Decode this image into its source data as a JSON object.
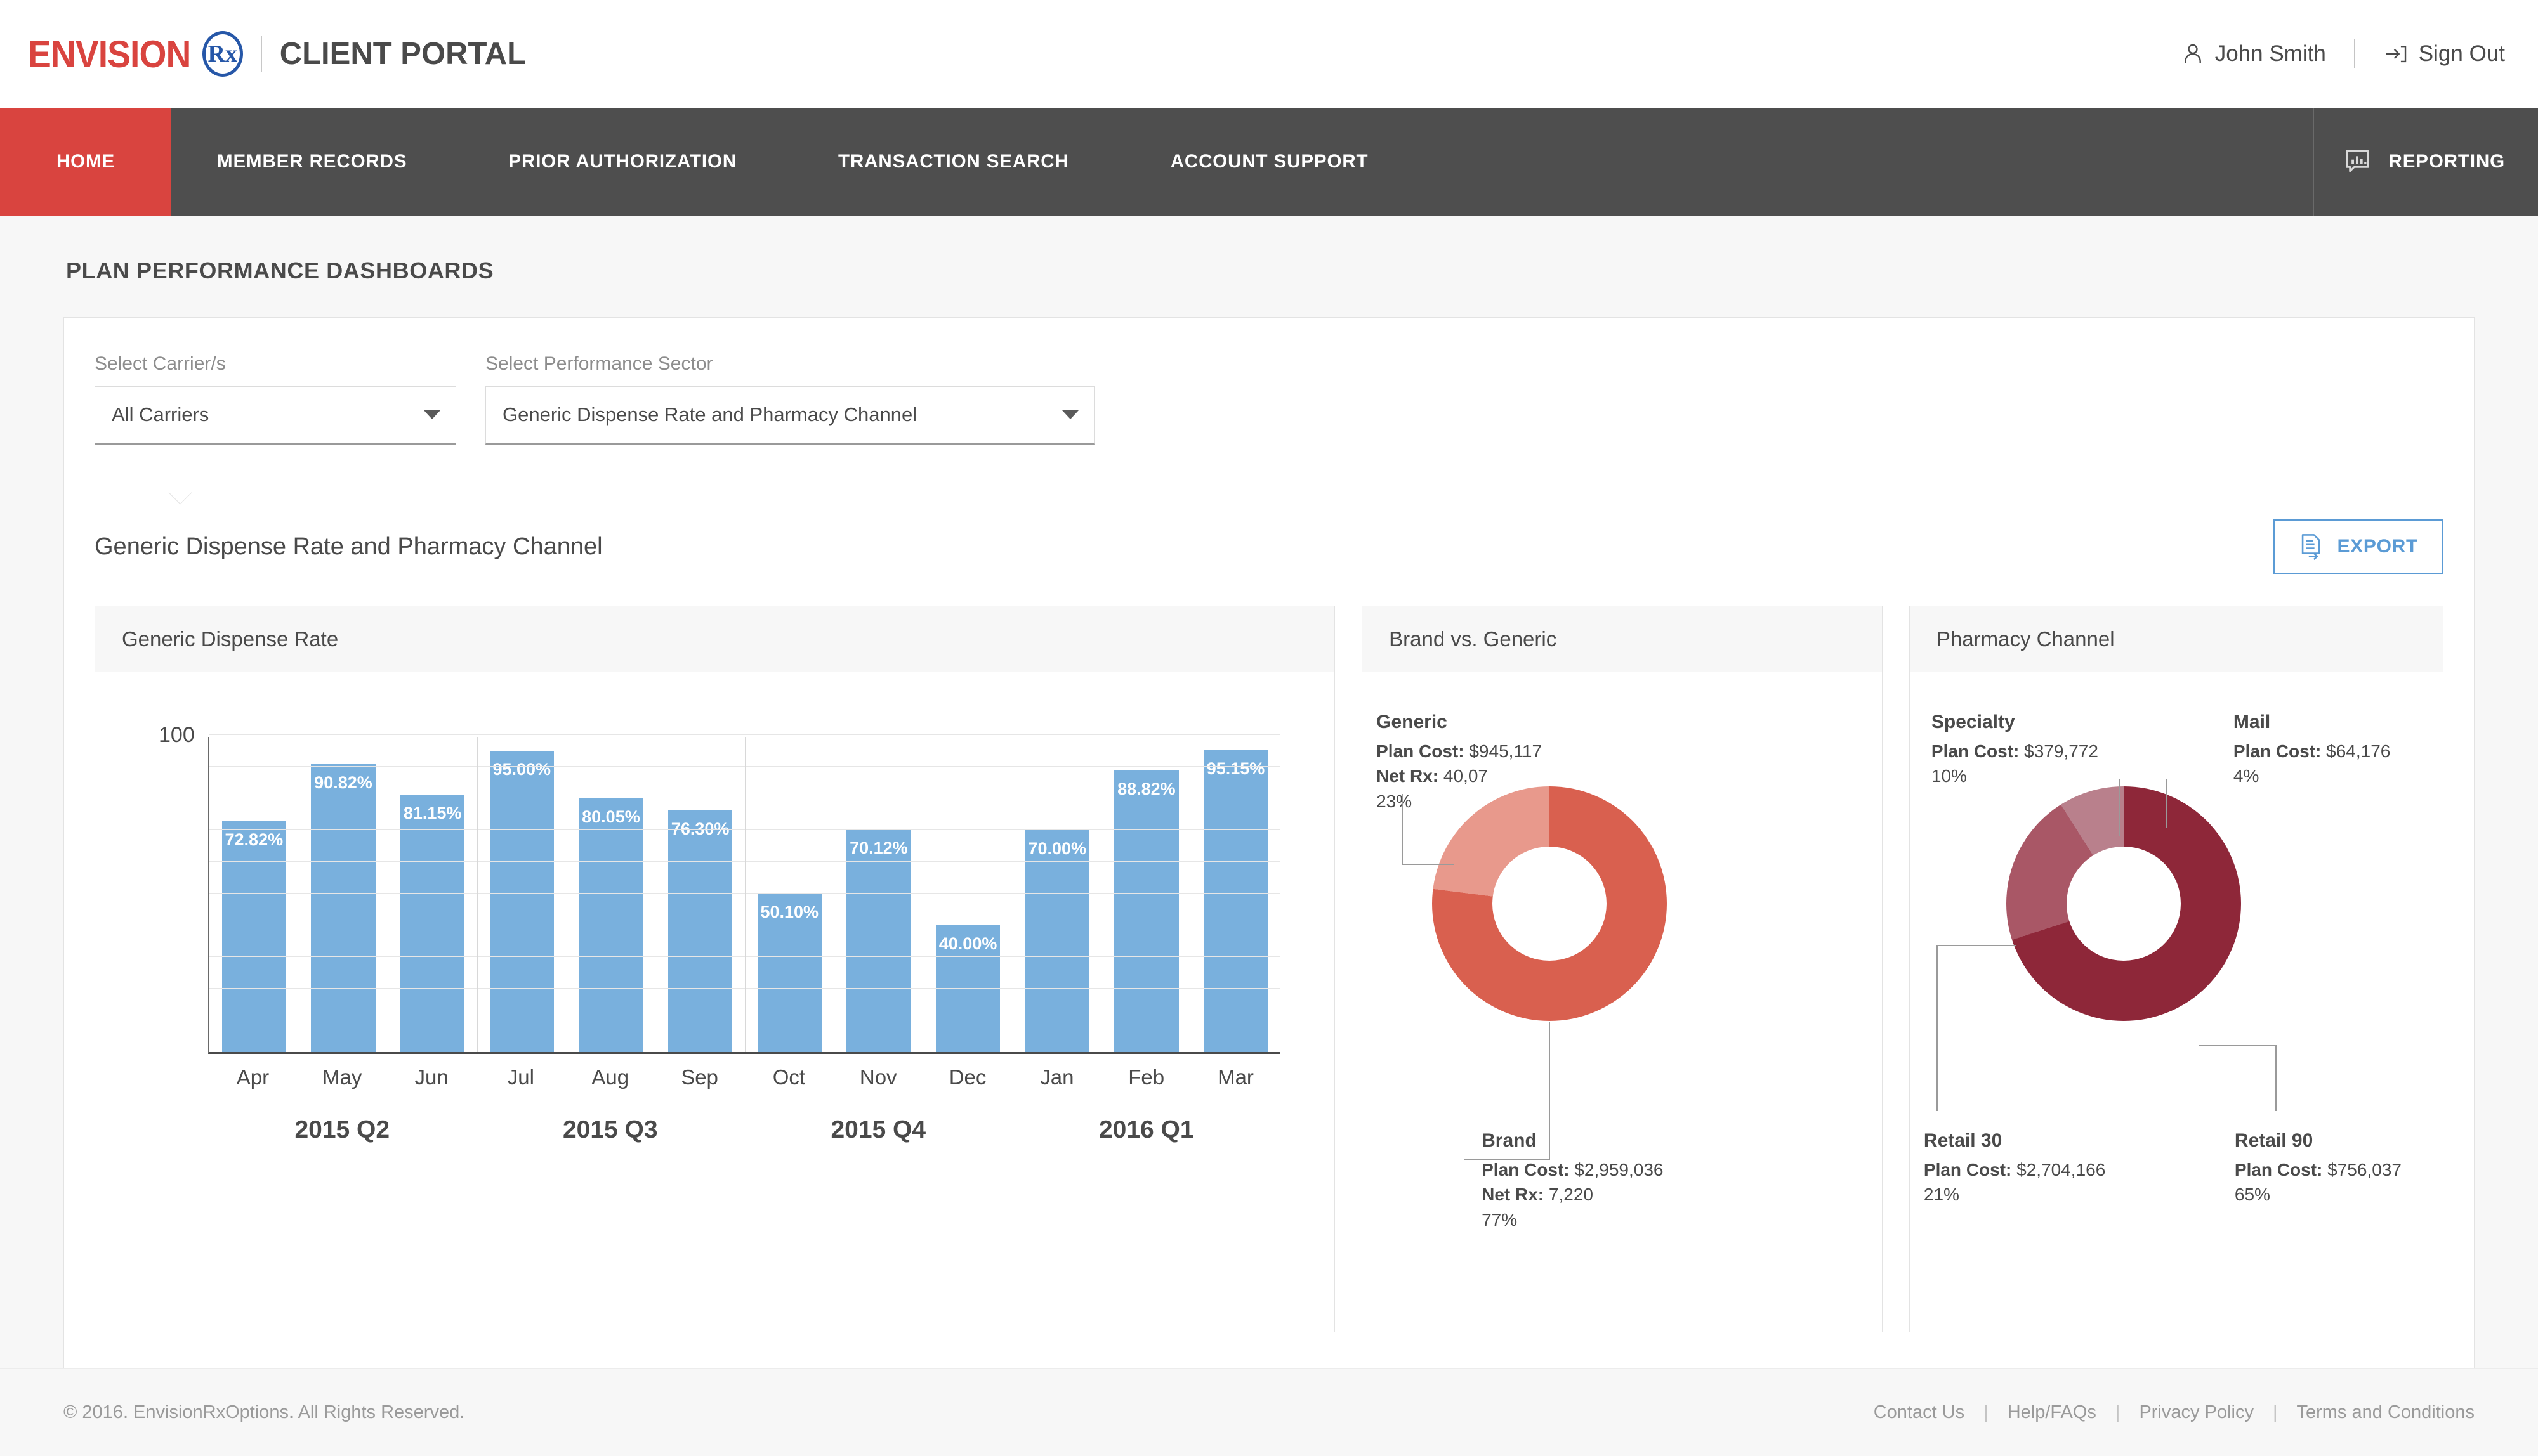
{
  "header": {
    "brand_name": "ENVISION",
    "brand_rx": "Rx",
    "portal_title": "CLIENT PORTAL",
    "user_name": "John Smith",
    "sign_out": "Sign Out"
  },
  "nav": {
    "items": [
      {
        "label": "HOME",
        "active": true
      },
      {
        "label": "MEMBER RECORDS",
        "active": false
      },
      {
        "label": "PRIOR AUTHORIZATION",
        "active": false
      },
      {
        "label": "TRANSACTION SEARCH",
        "active": false
      },
      {
        "label": "ACCOUNT SUPPORT",
        "active": false
      }
    ],
    "reporting": "REPORTING"
  },
  "page": {
    "title": "PLAN PERFORMANCE DASHBOARDS",
    "section_title": "Generic Dispense Rate and Pharmacy Channel",
    "export_label": "EXPORT"
  },
  "filters": {
    "carrier_label": "Select Carrier/s",
    "carrier_value": "All Carriers",
    "sector_label": "Select Performance Sector",
    "sector_value": "Generic Dispense Rate and Pharmacy Channel"
  },
  "cards": {
    "gdr_title": "Generic Dispense Rate",
    "bvg_title": "Brand vs. Generic",
    "channel_title": "Pharmacy Channel"
  },
  "chart_data": [
    {
      "type": "bar",
      "title": "Generic Dispense Rate",
      "categories": [
        "Apr",
        "May",
        "Jun",
        "Jul",
        "Aug",
        "Sep",
        "Oct",
        "Nov",
        "Dec",
        "Jan",
        "Feb",
        "Mar"
      ],
      "values": [
        72.82,
        90.82,
        81.15,
        95.0,
        80.05,
        76.3,
        50.1,
        70.12,
        40.0,
        70.0,
        88.82,
        95.15
      ],
      "data_labels": [
        "72.82%",
        "90.82%",
        "81.15%",
        "95.00%",
        "80.05%",
        "76.30%",
        "50.10%",
        "70.12%",
        "40.00%",
        "70.00%",
        "88.82%",
        "95.15%"
      ],
      "groups": [
        "2015 Q2",
        "2015 Q3",
        "2015 Q4",
        "2016 Q1"
      ],
      "ylim": [
        0,
        100
      ],
      "ytick_labels": [
        "100"
      ],
      "xlabel": "",
      "ylabel": "",
      "grid": true,
      "bar_color": "#79b0dd"
    },
    {
      "type": "pie",
      "title": "Brand vs. Generic",
      "categories": [
        "Brand",
        "Generic"
      ],
      "values": [
        77,
        23
      ],
      "colors": [
        "#d9604f",
        "#e8998c"
      ],
      "slices": [
        {
          "name": "Brand",
          "plan_cost_label": "Plan Cost:",
          "plan_cost": "$2,959,036",
          "net_rx_label": "Net Rx:",
          "net_rx": "7,220",
          "percent": "77%"
        },
        {
          "name": "Generic",
          "plan_cost_label": "Plan Cost:",
          "plan_cost": "$945,117",
          "net_rx_label": "Net Rx:",
          "net_rx": "40,07",
          "percent": "23%"
        }
      ]
    },
    {
      "type": "pie",
      "title": "Pharmacy Channel",
      "categories": [
        "Retail 90",
        "Retail 30",
        "Specialty",
        "Mail"
      ],
      "values": [
        65,
        21,
        10,
        4
      ],
      "colors": [
        "#8e2739",
        "#a95766",
        "#b9808c",
        "#cfa3ac"
      ],
      "slices": [
        {
          "name": "Retail 90",
          "plan_cost_label": "Plan Cost:",
          "plan_cost": "$756,037",
          "percent": "65%"
        },
        {
          "name": "Retail 30",
          "plan_cost_label": "Plan Cost:",
          "plan_cost": "$2,704,166",
          "percent": "21%"
        },
        {
          "name": "Specialty",
          "plan_cost_label": "Plan Cost:",
          "plan_cost": "$379,772",
          "percent": "10%"
        },
        {
          "name": "Mail",
          "plan_cost_label": "Plan Cost:",
          "plan_cost": "$64,176",
          "percent": "4%"
        }
      ]
    }
  ],
  "footer": {
    "copyright": "© 2016. EnvisionRxOptions. All Rights Reserved.",
    "links": [
      "Contact Us",
      "Help/FAQs",
      "Privacy Policy",
      "Terms and Conditions"
    ]
  },
  "colors": {
    "brand_red": "#d9443f",
    "nav_gray": "#4e4e4e",
    "accent_blue": "#5b9bd5",
    "bar_blue": "#79b0dd"
  }
}
